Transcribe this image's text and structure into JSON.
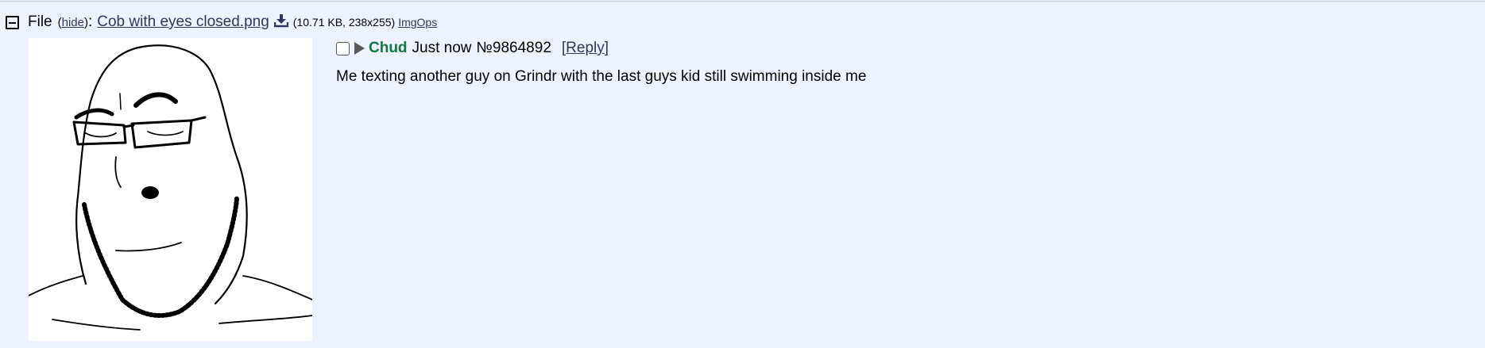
{
  "file": {
    "label": "File",
    "hide_text": "hide",
    "filename": "Cob with eyes closed.png",
    "meta": "(10.71 KB, 238x255)",
    "imgops": "ImgOps"
  },
  "post": {
    "name": "Chud",
    "time": "Just now",
    "number": "№9864892",
    "reply_label": "Reply",
    "message": "Me texting another guy on Grindr with the last guys kid still swimming inside me"
  },
  "colors": {
    "background": "#eef2ff",
    "name": "#117743",
    "link": "#34345c"
  },
  "icons": {
    "collapse": "minus-box-icon",
    "download": "download-icon",
    "expand": "triangle-right-icon"
  }
}
